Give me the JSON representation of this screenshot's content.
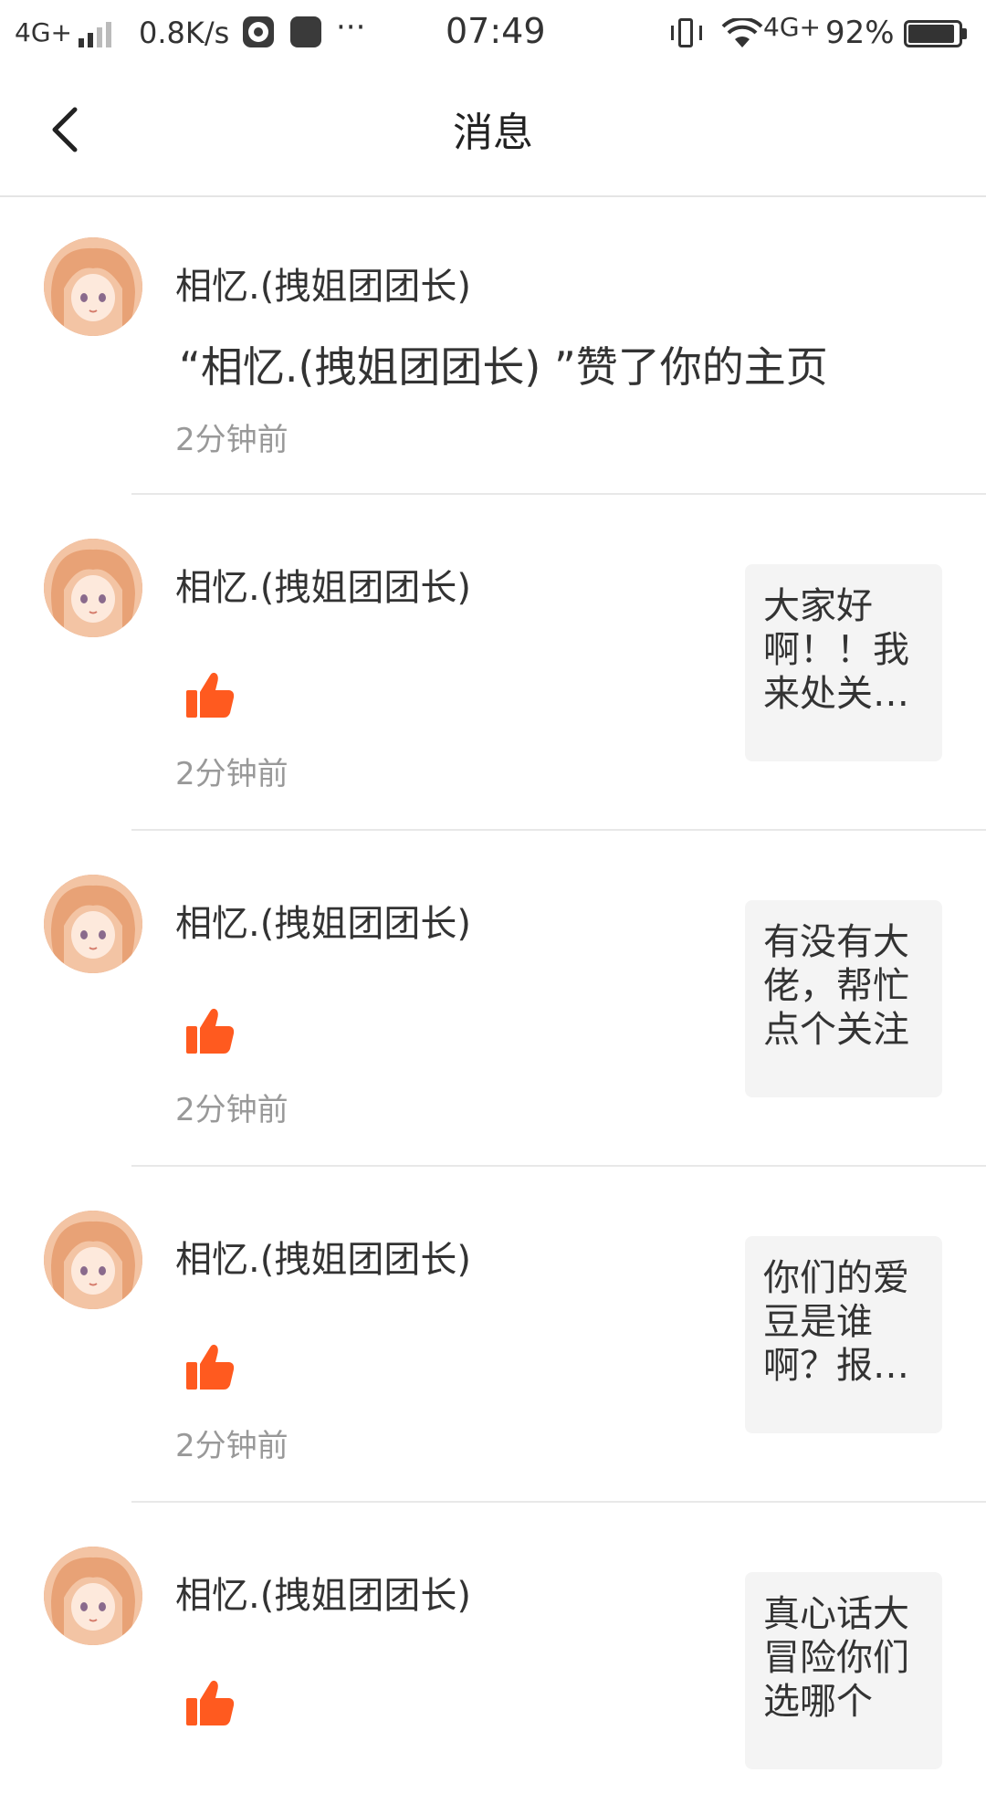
{
  "status_bar": {
    "network": "4G+",
    "speed": "0.8K/s",
    "more": "···",
    "time": "07:49",
    "network2": "4G+",
    "battery_text": "92%",
    "battery_level": 0.92
  },
  "header": {
    "back_icon": "chevron-left-icon",
    "title": "消息"
  },
  "messages": [
    {
      "type": "profile_like",
      "user": "相忆.(拽姐团团长)",
      "text": "“相忆.(拽姐团团长) ”赞了你的主页",
      "time": "2分钟前"
    },
    {
      "type": "post_like",
      "user": "相忆.(拽姐团团长)",
      "icon": "thumbs-up-icon",
      "time": "2分钟前",
      "preview": "大家好啊！！我来处关注的，互关"
    },
    {
      "type": "post_like",
      "user": "相忆.(拽姐团团长)",
      "icon": "thumbs-up-icon",
      "time": "2分钟前",
      "preview": "有没有大佬，帮忙点个关注"
    },
    {
      "type": "post_like",
      "user": "相忆.(拽姐团团长)",
      "icon": "thumbs-up-icon",
      "time": "2分钟前",
      "preview": "你们的爱豆是谁啊？报上名来"
    },
    {
      "type": "post_like",
      "user": "相忆.(拽姐团团长)",
      "icon": "thumbs-up-icon",
      "time": "",
      "preview": "真心话大冒险你们选哪个"
    }
  ],
  "colors": {
    "accent": "#ff5a1f",
    "text": "#333333",
    "secondary_text": "#999999",
    "divider": "#e8e8e8",
    "preview_bg": "#f4f4f4"
  }
}
